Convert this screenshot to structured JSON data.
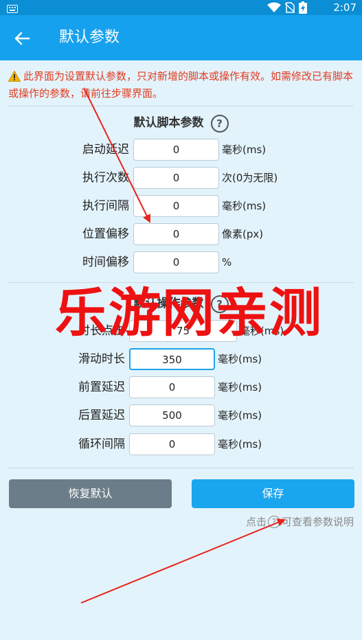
{
  "status_bar": {
    "time": "2:07"
  },
  "app_bar": {
    "title": "默认参数"
  },
  "warning": {
    "text": "此界面为设置默认参数，只对新增的脚本或操作有效。如需修改已有脚本或操作的参数，请前往步骤界面。"
  },
  "script_section": {
    "title": "默认脚本参数",
    "rows": [
      {
        "label": "启动延迟",
        "value": "0",
        "unit": "毫秒(ms)"
      },
      {
        "label": "执行次数",
        "value": "0",
        "unit": "次(0为无限)"
      },
      {
        "label": "执行间隔",
        "value": "0",
        "unit": "毫秒(ms)"
      },
      {
        "label": "位置偏移",
        "value": "0",
        "unit": "像素(px)"
      },
      {
        "label": "时间偏移",
        "value": "0",
        "unit": "%"
      }
    ]
  },
  "op_section": {
    "title": "默认操作参数",
    "rows": [
      {
        "label": "时长点击",
        "value": "75",
        "unit": "毫秒(ms)"
      },
      {
        "label": "滑动时长",
        "value": "350",
        "unit": "毫秒(ms)"
      },
      {
        "label": "前置延迟",
        "value": "0",
        "unit": "毫秒(ms)"
      },
      {
        "label": "后置延迟",
        "value": "500",
        "unit": "毫秒(ms)"
      },
      {
        "label": "循环间隔",
        "value": "0",
        "unit": "毫秒(ms)"
      }
    ]
  },
  "buttons": {
    "reset": "恢复默认",
    "save": "保存"
  },
  "hint": {
    "prefix": "点击",
    "suffix": "可查看参数说明"
  },
  "watermark": "乐游网亲测",
  "colors": {
    "app_bar": "#16a1ee",
    "status_bar": "#0b8ed3",
    "warning": "#e33b1f",
    "save": "#1aa6ee",
    "reset": "#6b7d89",
    "watermark": "#ee1111"
  }
}
